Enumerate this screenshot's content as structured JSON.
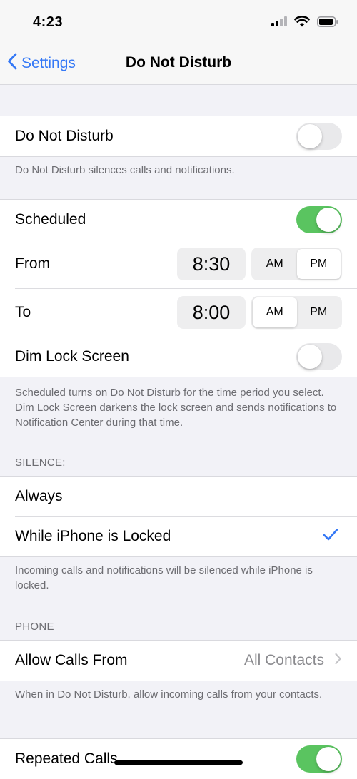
{
  "status": {
    "time": "4:23",
    "icons": [
      "signal-icon",
      "wifi-icon",
      "battery-icon"
    ]
  },
  "nav": {
    "back_label": "Settings",
    "title": "Do Not Disturb"
  },
  "dnd": {
    "label": "Do Not Disturb",
    "on": false,
    "note": "Do Not Disturb silences calls and notifications."
  },
  "schedule": {
    "scheduled_label": "Scheduled",
    "scheduled_on": true,
    "from_label": "From",
    "from_time": "8:30",
    "from_selected": "PM",
    "to_label": "To",
    "to_time": "8:00",
    "to_selected": "AM",
    "am": "AM",
    "pm": "PM",
    "dim_label": "Dim Lock Screen",
    "dim_on": false,
    "note": "Scheduled turns on Do Not Disturb for the time period you select. Dim Lock Screen darkens the lock screen and sends notifications to Notification Center during that time."
  },
  "silence": {
    "header": "SILENCE:",
    "always_label": "Always",
    "locked_label": "While iPhone is Locked",
    "selected": "While iPhone is Locked",
    "note": "Incoming calls and notifications will be silenced while iPhone is locked."
  },
  "phone": {
    "header": "PHONE",
    "allow_label": "Allow Calls From",
    "allow_value": "All Contacts",
    "note": "When in Do Not Disturb, allow incoming calls from your contacts.",
    "repeated_label": "Repeated Calls",
    "repeated_on": true
  },
  "colors": {
    "accent": "#3478f6",
    "toggle_on": "#5ac460",
    "toggle_off": "#e9e9eb",
    "background": "#f2f2f7"
  }
}
